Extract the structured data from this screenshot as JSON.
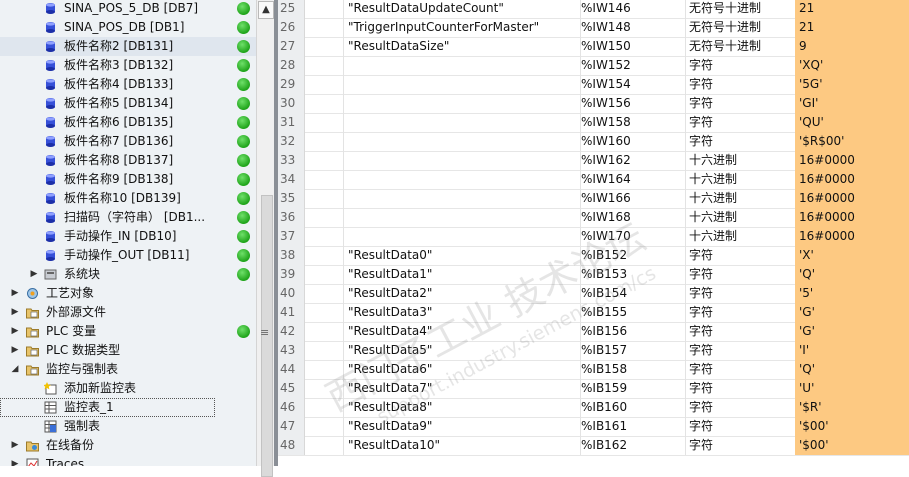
{
  "tree": {
    "items": [
      {
        "label": "SINA_POS_5_DB [DB7]",
        "icon": "db-icon",
        "level": 2,
        "status": "ok"
      },
      {
        "label": "SINA_POS_DB [DB1]",
        "icon": "db-icon",
        "level": 2,
        "status": "ok"
      },
      {
        "label": "板件名称2 [DB131]",
        "icon": "db-icon",
        "level": 2,
        "status": "ok",
        "selected": true
      },
      {
        "label": "板件名称3 [DB132]",
        "icon": "db-icon",
        "level": 2,
        "status": "ok"
      },
      {
        "label": "板件名称4 [DB133]",
        "icon": "db-icon",
        "level": 2,
        "status": "ok"
      },
      {
        "label": "板件名称5 [DB134]",
        "icon": "db-icon",
        "level": 2,
        "status": "ok"
      },
      {
        "label": "板件名称6 [DB135]",
        "icon": "db-icon",
        "level": 2,
        "status": "ok"
      },
      {
        "label": "板件名称7 [DB136]",
        "icon": "db-icon",
        "level": 2,
        "status": "ok"
      },
      {
        "label": "板件名称8 [DB137]",
        "icon": "db-icon",
        "level": 2,
        "status": "ok"
      },
      {
        "label": "板件名称9 [DB138]",
        "icon": "db-icon",
        "level": 2,
        "status": "ok"
      },
      {
        "label": "板件名称10 [DB139]",
        "icon": "db-icon",
        "level": 2,
        "status": "ok"
      },
      {
        "label": "扫描码（字符串） [DB1...",
        "icon": "db-icon",
        "level": 2,
        "status": "ok"
      },
      {
        "label": "手动操作_IN [DB10]",
        "icon": "db-icon",
        "level": 2,
        "status": "ok"
      },
      {
        "label": "手动操作_OUT [DB11]",
        "icon": "db-icon",
        "level": 2,
        "status": "ok"
      },
      {
        "label": "系统块",
        "icon": "system-block-icon",
        "level": 1,
        "expander": "collapsed",
        "status": "ok"
      },
      {
        "label": "工艺对象",
        "icon": "technology-objects-icon",
        "level": 0,
        "expander": "collapsed"
      },
      {
        "label": "外部源文件",
        "icon": "external-source-icon",
        "level": 0,
        "expander": "collapsed"
      },
      {
        "label": "PLC 变量",
        "icon": "plc-tags-icon",
        "level": 0,
        "expander": "collapsed",
        "status": "ok"
      },
      {
        "label": "PLC 数据类型",
        "icon": "plc-datatype-icon",
        "level": 0,
        "expander": "collapsed"
      },
      {
        "label": "监控与强制表",
        "icon": "watch-force-folder-icon",
        "level": 0,
        "expander": "expanded"
      },
      {
        "label": "添加新监控表",
        "icon": "add-watch-table-icon",
        "level": 1
      },
      {
        "label": "监控表_1",
        "icon": "watch-table-icon",
        "level": 1,
        "focused": true
      },
      {
        "label": "强制表",
        "icon": "force-table-icon",
        "level": 1
      },
      {
        "label": "在线备份",
        "icon": "online-backup-icon",
        "level": 0,
        "expander": "collapsed"
      },
      {
        "label": "Traces",
        "icon": "traces-icon",
        "level": 0,
        "expander": "collapsed"
      }
    ]
  },
  "table": {
    "rows": [
      {
        "num": "25",
        "name": "\"ResultDataUpdateCount\"",
        "address": "%IW146",
        "format": "无符号十进制",
        "value": "21"
      },
      {
        "num": "26",
        "name": "\"TriggerInputCounterForMaster\"",
        "address": "%IW148",
        "format": "无符号十进制",
        "value": "21"
      },
      {
        "num": "27",
        "name": "\"ResultDataSize\"",
        "address": "%IW150",
        "format": "无符号十进制",
        "value": "9"
      },
      {
        "num": "28",
        "name": "",
        "address": "%IW152",
        "format": "字符",
        "value": "'XQ'"
      },
      {
        "num": "29",
        "name": "",
        "address": "%IW154",
        "format": "字符",
        "value": "'5G'"
      },
      {
        "num": "30",
        "name": "",
        "address": "%IW156",
        "format": "字符",
        "value": "'GI'"
      },
      {
        "num": "31",
        "name": "",
        "address": "%IW158",
        "format": "字符",
        "value": "'QU'"
      },
      {
        "num": "32",
        "name": "",
        "address": "%IW160",
        "format": "字符",
        "value": "'$R$00'"
      },
      {
        "num": "33",
        "name": "",
        "address": "%IW162",
        "format": "十六进制",
        "value": "16#0000"
      },
      {
        "num": "34",
        "name": "",
        "address": "%IW164",
        "format": "十六进制",
        "value": "16#0000"
      },
      {
        "num": "35",
        "name": "",
        "address": "%IW166",
        "format": "十六进制",
        "value": "16#0000"
      },
      {
        "num": "36",
        "name": "",
        "address": "%IW168",
        "format": "十六进制",
        "value": "16#0000"
      },
      {
        "num": "37",
        "name": "",
        "address": "%IW170",
        "format": "十六进制",
        "value": "16#0000"
      },
      {
        "num": "38",
        "name": "\"ResultData0\"",
        "address": "%IB152",
        "format": "字符",
        "value": "'X'"
      },
      {
        "num": "39",
        "name": "\"ResultData1\"",
        "address": "%IB153",
        "format": "字符",
        "value": "'Q'"
      },
      {
        "num": "40",
        "name": "\"ResultData2\"",
        "address": "%IB154",
        "format": "字符",
        "value": "'5'"
      },
      {
        "num": "41",
        "name": "\"ResultData3\"",
        "address": "%IB155",
        "format": "字符",
        "value": "'G'"
      },
      {
        "num": "42",
        "name": "\"ResultData4\"",
        "address": "%IB156",
        "format": "字符",
        "value": "'G'"
      },
      {
        "num": "43",
        "name": "\"ResultData5\"",
        "address": "%IB157",
        "format": "字符",
        "value": "'I'"
      },
      {
        "num": "44",
        "name": "\"ResultData6\"",
        "address": "%IB158",
        "format": "字符",
        "value": "'Q'"
      },
      {
        "num": "45",
        "name": "\"ResultData7\"",
        "address": "%IB159",
        "format": "字符",
        "value": "'U'"
      },
      {
        "num": "46",
        "name": "\"ResultData8\"",
        "address": "%IB160",
        "format": "字符",
        "value": "'$R'"
      },
      {
        "num": "47",
        "name": "\"ResultData9\"",
        "address": "%IB161",
        "format": "字符",
        "value": "'$00'"
      },
      {
        "num": "48",
        "name": "\"ResultData10\"",
        "address": "%IB162",
        "format": "字符",
        "value": "'$00'"
      }
    ]
  },
  "watermark": {
    "line1": "西门子工业 技术论坛",
    "line2": "support.industry.siemens.com/cs"
  },
  "colors": {
    "monitor_value_bg": "#fdc982",
    "status_ok": "#1fa41a",
    "db_icon": "#3650d8",
    "tree_bg": "#eef2f5"
  }
}
